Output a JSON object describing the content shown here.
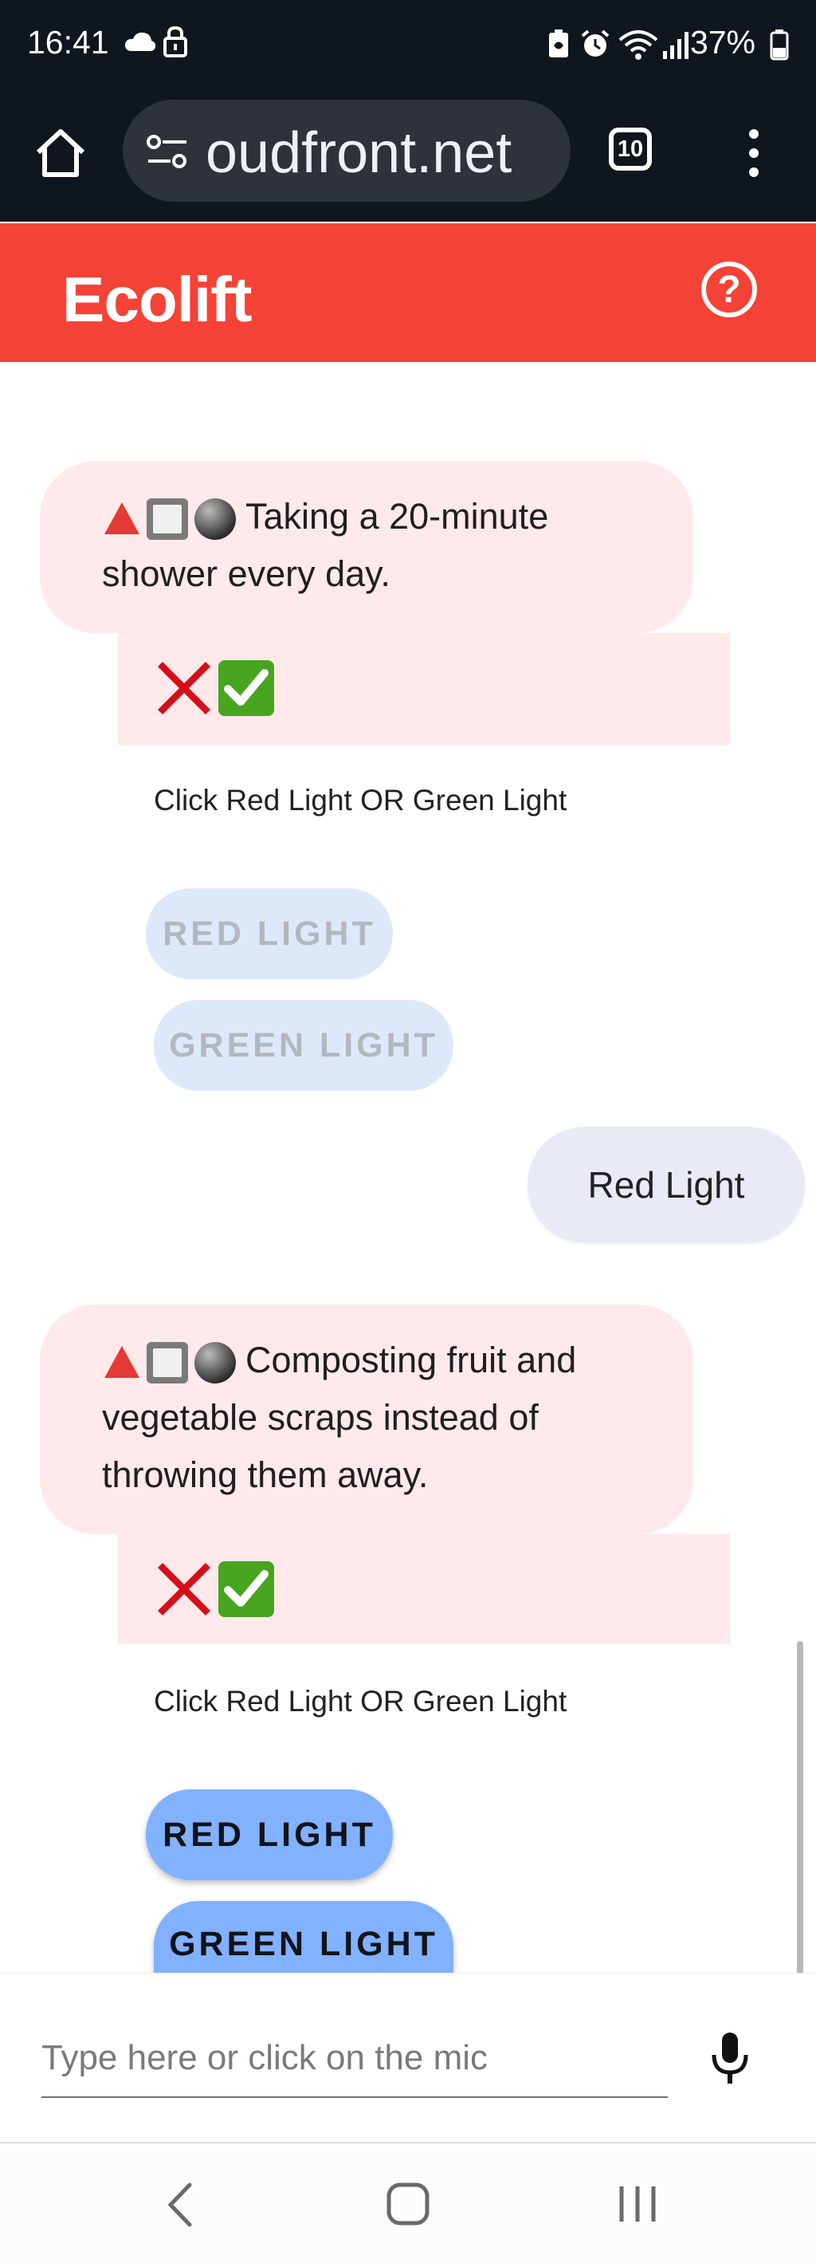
{
  "status_bar": {
    "time": "16:41",
    "battery": "37%",
    "icons": [
      "cloud-icon",
      "lock-icon",
      "battery-saver-icon",
      "alarm-icon",
      "wifi-icon",
      "signal-icon",
      "battery-icon"
    ]
  },
  "browser": {
    "url_display": "oudfront.net",
    "tab_count": "10",
    "icons": [
      "home-icon",
      "site-settings-icon",
      "tab-switcher-icon",
      "more-menu-icon"
    ]
  },
  "app": {
    "title": "Ecolift",
    "brand_color": "#f44336",
    "help_icon": "help-circle-icon"
  },
  "chat": {
    "messages": [
      {
        "type": "bot",
        "text": "Taking a 20-minute shower every day.",
        "marks": [
          "cross-mark-icon",
          "check-mark-icon"
        ],
        "hint": "Click Red Light OR Green Light",
        "buttons": [
          {
            "label": "Red Light",
            "state": "disabled"
          },
          {
            "label": "Green Light",
            "state": "disabled"
          }
        ]
      },
      {
        "type": "user",
        "text": "Red Light"
      },
      {
        "type": "bot",
        "text": "Composting fruit and vegetable scraps instead of throwing them away.",
        "marks": [
          "cross-mark-icon",
          "check-mark-icon"
        ],
        "hint": "Click Red Light OR Green Light",
        "buttons": [
          {
            "label": "Red Light",
            "state": "active"
          },
          {
            "label": "Green Light",
            "state": "active"
          }
        ]
      }
    ]
  },
  "input": {
    "placeholder": "Type here or click on the mic",
    "value": "",
    "mic_icon": "microphone-icon"
  },
  "nav_bar": {
    "icons": [
      "back-icon",
      "home-button-icon",
      "recent-apps-icon"
    ]
  }
}
